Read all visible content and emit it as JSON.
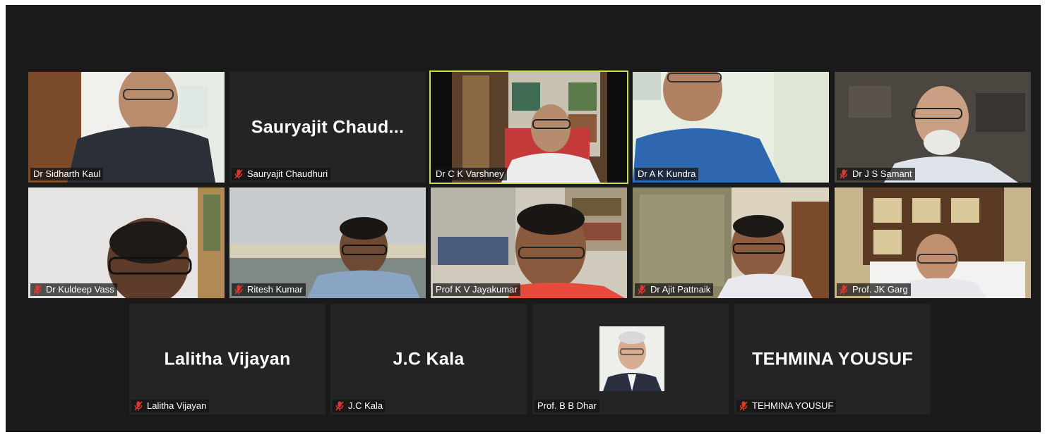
{
  "meeting": {
    "tiles": [
      {
        "name": "Dr Sidharth Kaul",
        "muted": false,
        "video": true,
        "big_name": ""
      },
      {
        "name": "Sauryajit Chaudhuri",
        "muted": true,
        "video": false,
        "big_name": "Sauryajit  Chaud..."
      },
      {
        "name": "Dr C K Varshney",
        "muted": false,
        "video": true,
        "big_name": "",
        "active_speaker": true
      },
      {
        "name": "Dr A K Kundra",
        "muted": false,
        "video": true,
        "big_name": ""
      },
      {
        "name": "Dr J S Samant",
        "muted": true,
        "video": true,
        "big_name": ""
      },
      {
        "name": "Dr Kuldeep Vass",
        "muted": true,
        "video": true,
        "big_name": ""
      },
      {
        "name": "Ritesh Kumar",
        "muted": true,
        "video": true,
        "big_name": ""
      },
      {
        "name": "Prof K V Jayakumar",
        "muted": false,
        "video": true,
        "big_name": ""
      },
      {
        "name": "Dr Ajit Pattnaik",
        "muted": true,
        "video": true,
        "big_name": ""
      },
      {
        "name": "Prof. JK Garg",
        "muted": true,
        "video": true,
        "big_name": ""
      },
      {
        "name": "Lalitha Vijayan",
        "muted": true,
        "video": false,
        "big_name": "Lalitha Vijayan"
      },
      {
        "name": "J.C Kala",
        "muted": true,
        "video": false,
        "big_name": "J.C Kala"
      },
      {
        "name": "Prof. B B Dhar",
        "muted": false,
        "video": false,
        "big_name": "",
        "profile_photo": true
      },
      {
        "name": "TEHMINA YOUSUF",
        "muted": true,
        "video": false,
        "big_name": "TEHMINA YOUSUF"
      }
    ]
  },
  "colors": {
    "background": "#1a1a1a",
    "tile": "#242424",
    "active_border": "#c9dc5a",
    "muted_icon": "#e0382f"
  },
  "icons": {
    "muted": "muted-mic-icon"
  }
}
